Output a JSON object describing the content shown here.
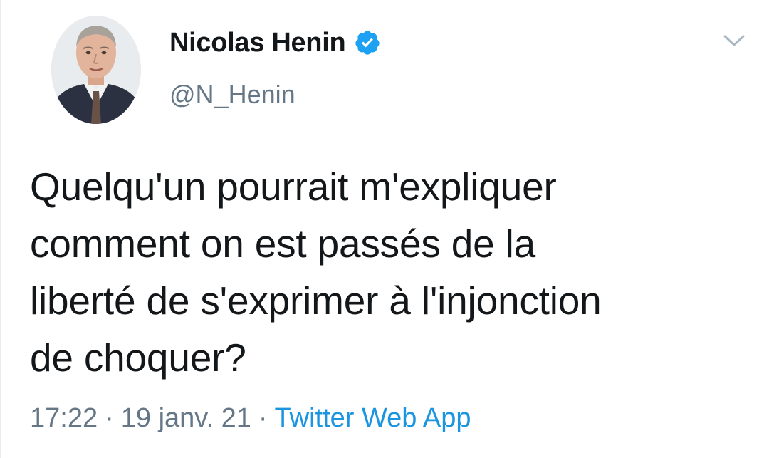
{
  "tweet": {
    "author": {
      "display_name": "Nicolas Henin",
      "handle": "@N_Henin",
      "verified_icon": "verified-badge-icon",
      "avatar": "profile-photo"
    },
    "menu_icon": "chevron-down-icon",
    "text_lines": [
      "Quelqu'un pourrait m'expliquer",
      "comment on est passés de la",
      "liberté de s'exprimer à l'injonction",
      "de choquer?"
    ],
    "meta": {
      "time": "17:22",
      "separator": "·",
      "date": "19 janv. 21",
      "source": "Twitter Web App"
    }
  },
  "colors": {
    "text_primary": "#14171a",
    "text_secondary": "#657786",
    "accent": "#1b95e0",
    "verified": "#1da1f2"
  }
}
